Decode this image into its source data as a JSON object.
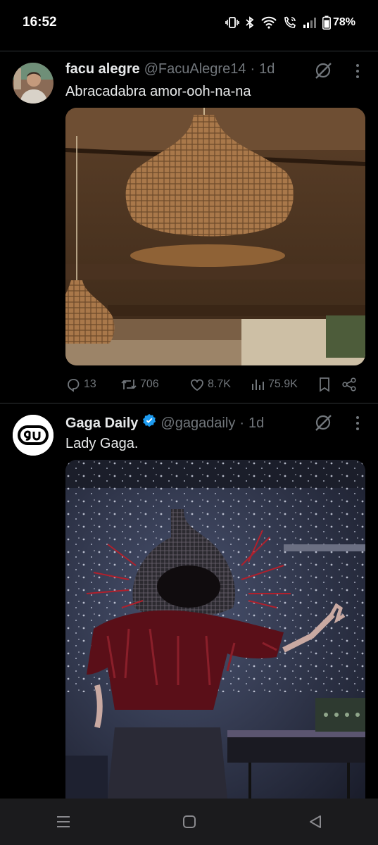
{
  "status_bar": {
    "time": "16:52",
    "battery": "78%"
  },
  "tweets": [
    {
      "display_name": "facu alegre",
      "handle": "@FacuAlegre14",
      "separator": "·",
      "time": "1d",
      "text": "Abracadabra amor-ooh-na-na",
      "stats": {
        "replies": "13",
        "retweets": "706",
        "likes": "8.7K",
        "views": "75.9K"
      }
    },
    {
      "display_name": "Gaga Daily",
      "handle": "@gagadaily",
      "separator": "·",
      "time": "1d",
      "text": "Lady Gaga.",
      "verified": true
    }
  ],
  "colors": {
    "background": "#000000",
    "text": "#e7e9ea",
    "muted": "#71767b",
    "verified": "#1d9bf0"
  }
}
